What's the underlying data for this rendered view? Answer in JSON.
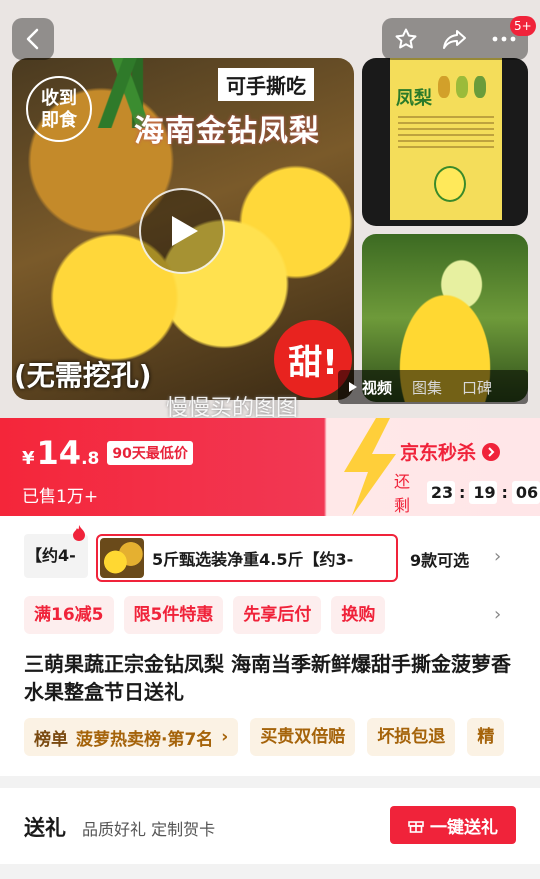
{
  "gallery": {
    "stamp_line1": "收到",
    "stamp_line2": "即食",
    "tagline": "可手撕吃",
    "title_overlay": "海南金钻凤梨",
    "hint_overlay": "(无需挖孔)",
    "sweet_badge": "甜!",
    "watermark": "慢慢买的图图",
    "card_title": "凤梨",
    "media_tabs": [
      {
        "label": "视频",
        "active": true
      },
      {
        "label": "图集",
        "active": false
      },
      {
        "label": "口碑",
        "active": false
      }
    ]
  },
  "topbar": {
    "back_icon": "chevron-left-icon",
    "icons": [
      "star-icon",
      "share-icon",
      "more-icon"
    ],
    "msg_badge": "5+"
  },
  "price": {
    "currency": "¥",
    "integer": "14",
    "decimal": ".8",
    "lowest_tag": "90天最低价",
    "sold": "已售1万+",
    "flash_title": "京东秒杀",
    "countdown_label": "还剩",
    "hh": "23",
    "mm": "19",
    "ss": "06",
    "colors": {
      "primary": "#f0233a",
      "gold": "#ffcf3a"
    }
  },
  "spec": {
    "prev_label": "【约4-",
    "current_label": "5斤甄选装净重4.5斤【约3-",
    "count": "9款可选"
  },
  "promos": [
    "满16减5",
    "限5件特惠",
    "先享后付",
    "换购"
  ],
  "product": {
    "title": "三萌果蔬正宗金钻凤梨 海南当季新鲜爆甜手撕金菠萝香水果整盒节日送礼"
  },
  "rank": {
    "key": "榜单",
    "value": "菠萝热卖榜·第7名"
  },
  "service_chips": [
    "买贵双倍赔",
    "坏损包退",
    "精"
  ],
  "gift": {
    "title": "送礼",
    "desc": "品质好礼 定制贺卡",
    "button": "一键送礼"
  }
}
